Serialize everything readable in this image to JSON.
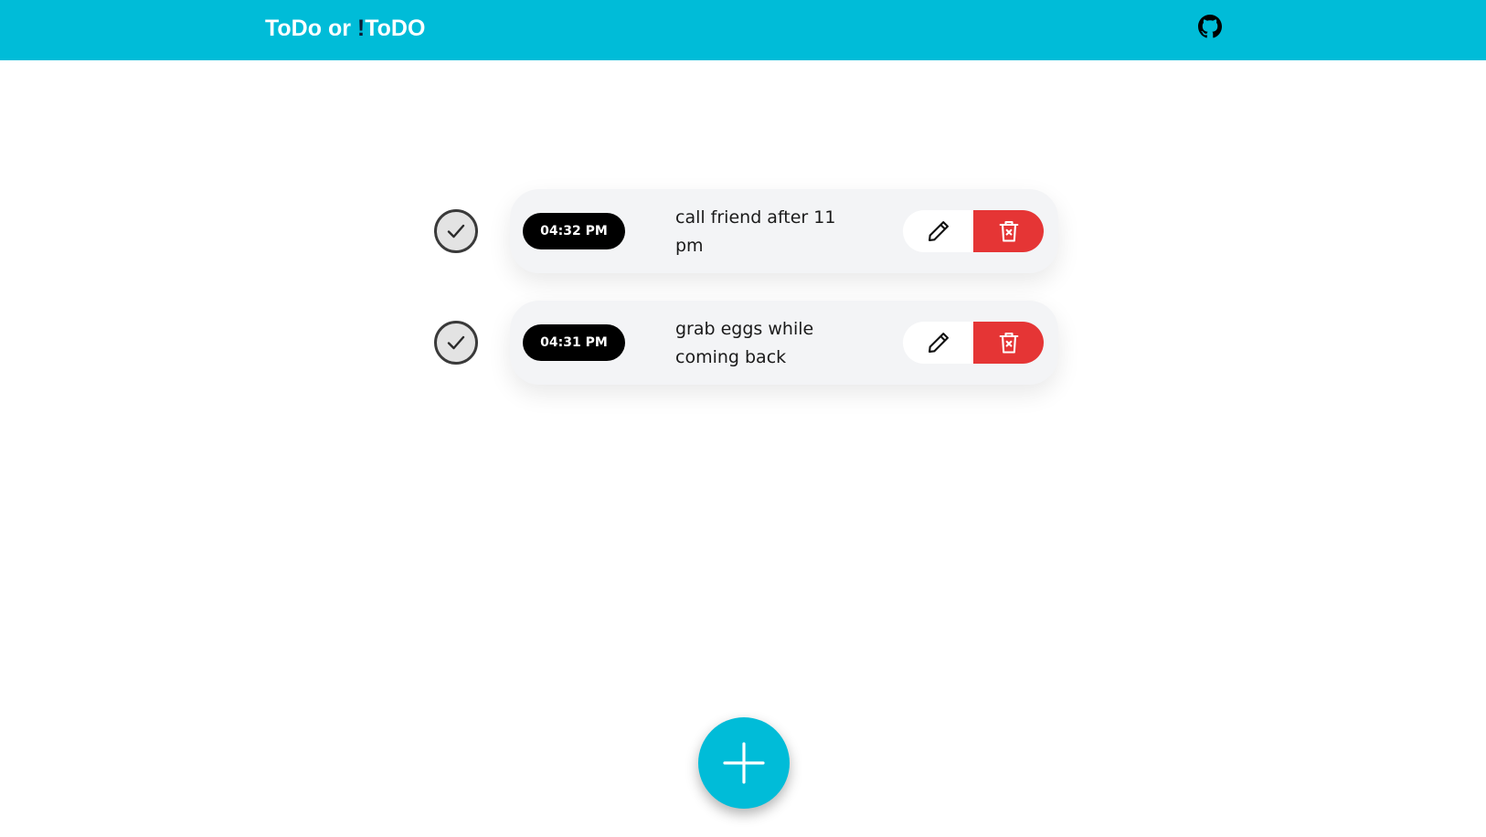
{
  "header": {
    "brand_part1": "ToDo or ",
    "brand_bang": "!",
    "brand_part2": "ToDO",
    "github_icon": "github-icon"
  },
  "colors": {
    "header_bg": "#00bcd8",
    "brand_accent": "#0d1b33",
    "delete_bg": "#e53535",
    "time_badge_bg": "#000000",
    "card_bg": "#f3f4f6",
    "fab_bg": "#00bcd8"
  },
  "todos": [
    {
      "time": "04:32 PM",
      "text": "call friend after 11 pm",
      "check_icon": "check-circle-icon",
      "edit_icon": "pencil-icon",
      "delete_icon": "trash-icon"
    },
    {
      "time": "04:31 PM",
      "text": "grab eggs while coming back",
      "check_icon": "check-circle-icon",
      "edit_icon": "pencil-icon",
      "delete_icon": "trash-icon"
    }
  ],
  "add_button": {
    "icon": "plus-icon"
  }
}
